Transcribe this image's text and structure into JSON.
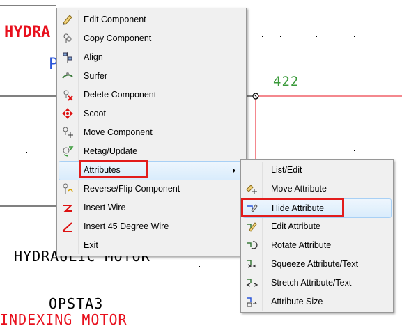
{
  "drawing": {
    "texts": {
      "title_top": "HYDRA",
      "letter_p": "P",
      "wire_number": "422",
      "hydraulic_motor": "HYDRAULIC MOTOR",
      "opsta3": "OPSTA3",
      "indexing_motor": "INDEXING MOTOR"
    },
    "colors": {
      "red": "#e8101d",
      "green": "#3a9a3a",
      "blue": "#2a55d8",
      "black": "#000000"
    }
  },
  "context_menu": {
    "items": [
      {
        "label": "Edit Component",
        "icon": "edit-component-icon"
      },
      {
        "label": "Copy Component",
        "icon": "copy-component-icon"
      },
      {
        "label": "Align",
        "icon": "align-icon"
      },
      {
        "label": "Surfer",
        "icon": "surfer-icon"
      },
      {
        "label": "Delete Component",
        "icon": "delete-component-icon"
      },
      {
        "label": "Scoot",
        "icon": "scoot-icon"
      },
      {
        "label": "Move Component",
        "icon": "move-component-icon"
      },
      {
        "label": "Retag/Update",
        "icon": "retag-update-icon"
      },
      {
        "label": "Attributes",
        "icon": "",
        "submenu": true
      },
      {
        "label": "Reverse/Flip Component",
        "icon": "reverse-flip-icon"
      },
      {
        "label": "Insert Wire",
        "icon": "insert-wire-icon"
      },
      {
        "label": "Insert 45 Degree Wire",
        "icon": "insert-45-wire-icon"
      },
      {
        "label": "Exit",
        "icon": ""
      }
    ]
  },
  "attributes_submenu": {
    "items": [
      {
        "label": "List/Edit",
        "icon": ""
      },
      {
        "label": "Move Attribute",
        "icon": "move-attribute-icon"
      },
      {
        "label": "Hide Attribute",
        "icon": "hide-attribute-icon"
      },
      {
        "label": "Edit Attribute",
        "icon": "edit-attribute-icon"
      },
      {
        "label": "Rotate Attribute",
        "icon": "rotate-attribute-icon"
      },
      {
        "label": "Squeeze Attribute/Text",
        "icon": "squeeze-attribute-icon"
      },
      {
        "label": "Stretch Attribute/Text",
        "icon": "stretch-attribute-icon"
      },
      {
        "label": "Attribute Size",
        "icon": "attribute-size-icon"
      }
    ]
  },
  "highlight_color": "#e21c1c"
}
